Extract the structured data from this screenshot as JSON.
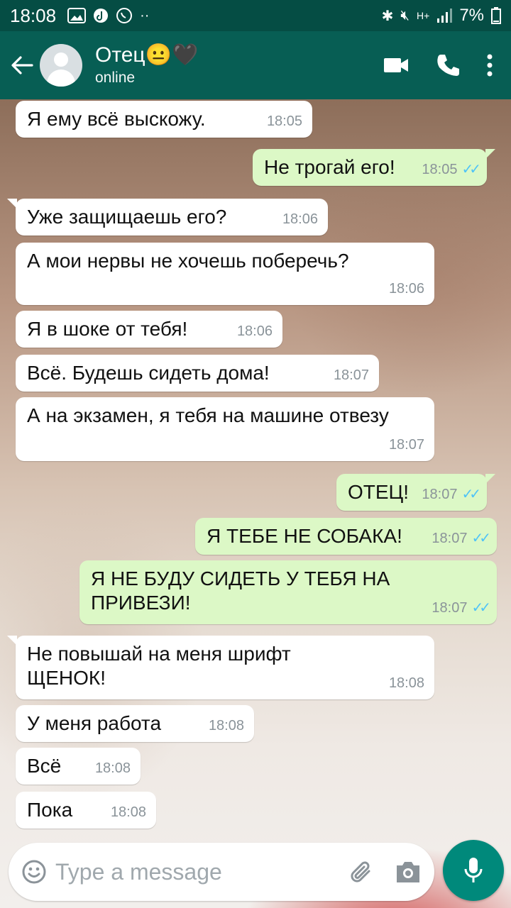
{
  "status_bar": {
    "time": "18:08",
    "network": "H+",
    "battery": "7%",
    "left_icons": [
      "image-icon",
      "tiktok-icon",
      "whatsapp-icon",
      "more-dots-icon"
    ],
    "right_icons": [
      "bluetooth-icon",
      "mute-icon",
      "network-icon",
      "signal-icon",
      "battery-icon"
    ]
  },
  "header": {
    "contact_name": "Отец😐🖤",
    "status": "online",
    "colors": {
      "appbar": "#075e54",
      "statusbar": "#054d44"
    }
  },
  "messages": [
    {
      "dir": "in",
      "text": "Я ему всё выскожу.",
      "time": "18:05"
    },
    {
      "dir": "out",
      "text": "Не трогай его!",
      "time": "18:05",
      "read": true
    },
    {
      "dir": "in",
      "text": "Уже защищаешь его?",
      "time": "18:06"
    },
    {
      "dir": "in",
      "text": "А мои нервы не хочешь поберечь?",
      "time": "18:06"
    },
    {
      "dir": "in",
      "text": "Я в шоке от тебя!",
      "time": "18:06"
    },
    {
      "dir": "in",
      "text": "Всё. Будешь сидеть дома!",
      "time": "18:07"
    },
    {
      "dir": "in",
      "text": "А на экзамен, я тебя на машине отвезу",
      "time": "18:07"
    },
    {
      "dir": "out",
      "text": "ОТЕЦ!",
      "time": "18:07",
      "read": true
    },
    {
      "dir": "out",
      "text": "Я ТЕБЕ НЕ СОБАКА!",
      "time": "18:07",
      "read": true
    },
    {
      "dir": "out",
      "text": "Я НЕ БУДУ СИДЕТЬ У ТЕБЯ НА ПРИВЕЗИ!",
      "time": "18:07",
      "read": true
    },
    {
      "dir": "in",
      "text": "Не повышай на меня шрифт ЩЕНОК!",
      "time": "18:08"
    },
    {
      "dir": "in",
      "text": "У меня работа",
      "time": "18:08"
    },
    {
      "dir": "in",
      "text": "Всё",
      "time": "18:08"
    },
    {
      "dir": "in",
      "text": "Пока",
      "time": "18:08"
    }
  ],
  "composer": {
    "placeholder": "Type a message"
  },
  "colors": {
    "incoming_bubble": "#ffffff",
    "outgoing_bubble": "#dcf8c6",
    "read_ticks": "#4fc3f7",
    "mic_button": "#00897b"
  }
}
